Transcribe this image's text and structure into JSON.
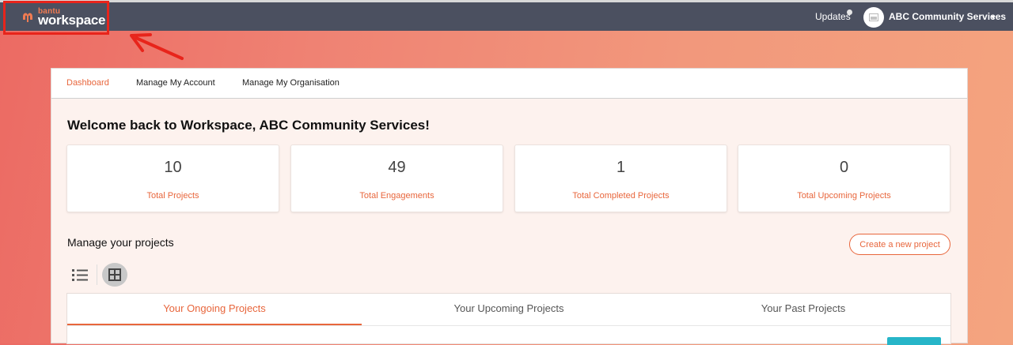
{
  "header": {
    "logo": {
      "small": "bantu",
      "big": "workspace"
    },
    "updates_label": "Updates",
    "org_name": "ABC Community Services"
  },
  "nav": {
    "items": [
      {
        "label": "Dashboard",
        "active": true
      },
      {
        "label": "Manage My Account",
        "active": false
      },
      {
        "label": "Manage My Organisation",
        "active": false
      }
    ]
  },
  "welcome": "Welcome back to Workspace, ABC Community Services!",
  "stats": [
    {
      "value": "10",
      "label": "Total Projects"
    },
    {
      "value": "49",
      "label": "Total Engagements"
    },
    {
      "value": "1",
      "label": "Total Completed Projects"
    },
    {
      "value": "0",
      "label": "Total Upcoming Projects"
    }
  ],
  "projects": {
    "title": "Manage your projects",
    "create_label": "Create a new project",
    "tabs": [
      {
        "label": "Your Ongoing Projects",
        "active": true
      },
      {
        "label": "Your Upcoming Projects",
        "active": false
      },
      {
        "label": "Your Past Projects",
        "active": false
      }
    ]
  },
  "colors": {
    "accent": "#e8663c",
    "topbar": "#4b5060",
    "highlight": "#e8241b",
    "teal": "#27b5c8"
  }
}
